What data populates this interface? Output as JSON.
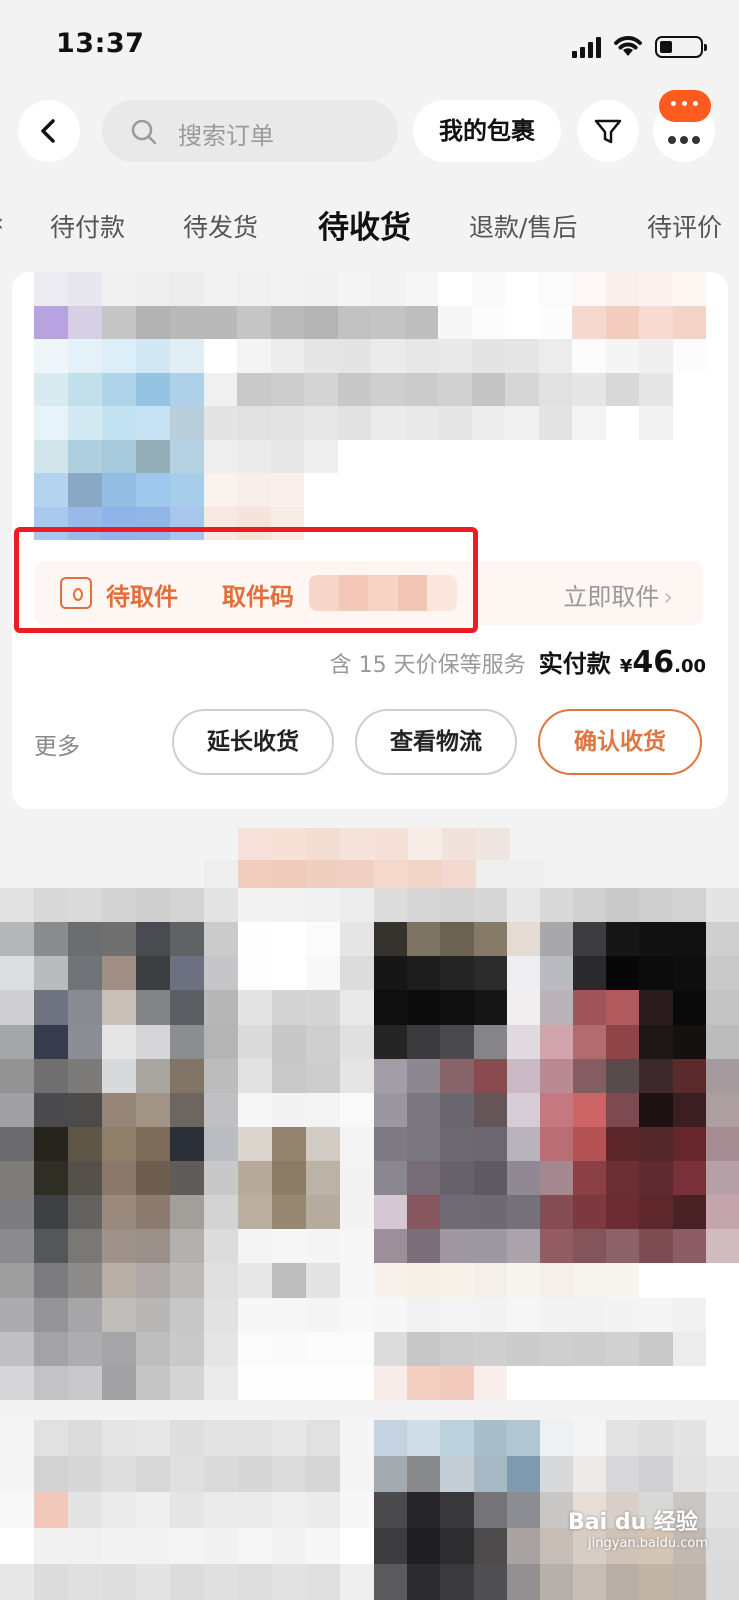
{
  "status": {
    "time": "13:37"
  },
  "nav": {
    "search_placeholder": "搜索订单",
    "my_packages": "我的包裹"
  },
  "tabs": {
    "items": [
      "待付款",
      "待发货",
      "待收货",
      "退款/售后",
      "待评价"
    ],
    "active": "待收货"
  },
  "order": {
    "pickup": {
      "status": "待取件",
      "code_label": "取件码",
      "action": "立即取件",
      "action_icon": "chevron-right-icon"
    },
    "price": {
      "note": "含 15 天价保等服务",
      "label": "实付款",
      "symbol": "¥",
      "integer": "46",
      "decimal": ".00"
    },
    "actions": {
      "more": "更多",
      "extend": "延长收货",
      "logistics": "查看物流",
      "confirm": "确认收货"
    }
  },
  "watermark": {
    "brand": "Bai du 经验",
    "url": "jingyan.baidu.com"
  },
  "colors": {
    "accent": "#e26f3a",
    "highlight": "#ec1c24",
    "badge": "#ff5a1f"
  }
}
